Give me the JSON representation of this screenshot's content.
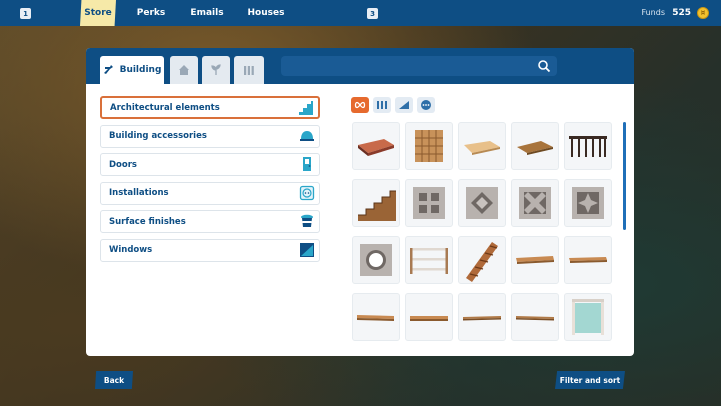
{
  "topbar": {
    "key_left": "1",
    "key_right": "3",
    "nav": [
      {
        "label": "Store",
        "active": true
      },
      {
        "label": "Perks",
        "active": false
      },
      {
        "label": "Emails",
        "active": false
      },
      {
        "label": "Houses",
        "active": false
      }
    ],
    "funds_label": "Funds",
    "funds_value": "525",
    "coin_icon": "coin-icon"
  },
  "tabs": [
    {
      "label": "Building",
      "icon": "hammer-icon",
      "active": true
    },
    {
      "label": "",
      "icon": "house-icon",
      "active": false
    },
    {
      "label": "",
      "icon": "plant-icon",
      "active": false
    },
    {
      "label": "",
      "icon": "fence-icon",
      "active": false
    }
  ],
  "search": {
    "placeholder": "",
    "value": ""
  },
  "categories": [
    {
      "label": "Architectural elements",
      "icon": "stairs-icon",
      "selected": true
    },
    {
      "label": "Building accessories",
      "icon": "helmet-icon",
      "selected": false
    },
    {
      "label": "Doors",
      "icon": "door-icon",
      "selected": false
    },
    {
      "label": "Installations",
      "icon": "socket-icon",
      "selected": false
    },
    {
      "label": "Surface finishes",
      "icon": "paint-bucket-icon",
      "selected": false
    },
    {
      "label": "Windows",
      "icon": "window-icon",
      "selected": false
    }
  ],
  "filters": [
    {
      "icon": "infinity-icon",
      "active": true
    },
    {
      "icon": "columns-icon",
      "active": false
    },
    {
      "icon": "ramp-icon",
      "active": false
    },
    {
      "icon": "more-icon",
      "active": false
    }
  ],
  "items": [
    "brick-slab",
    "wooden-lattice-panel",
    "wooden-beam-angled",
    "wooden-beam-short",
    "dark-railing",
    "wooden-stairs",
    "breeze-block-square",
    "breeze-block-diamond",
    "breeze-block-cross",
    "breeze-block-star",
    "breeze-block-circle",
    "white-railing",
    "wooden-stair-stringer",
    "wooden-plank",
    "wooden-plank-thin",
    "wooden-board",
    "wooden-board-long",
    "wooden-strip",
    "wooden-strip-long",
    "glass-balustrade"
  ],
  "footer": {
    "back_label": "Back",
    "filter_label": "Filter and sort"
  },
  "colors": {
    "primary": "#0e4e84",
    "accent": "#e66a2e",
    "active_tab": "#f6e9a8"
  }
}
